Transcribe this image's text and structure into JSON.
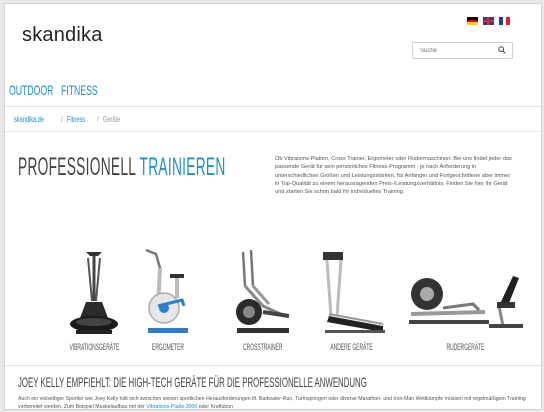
{
  "logo": "skandika",
  "languages": [
    {
      "code": "de",
      "colors": [
        "#000000",
        "#dd0000",
        "#ffce00"
      ]
    },
    {
      "code": "en",
      "colors": [
        "#2d3d8a",
        "#e22233",
        "#ffffff"
      ]
    },
    {
      "code": "fr",
      "colors": [
        "#1f3d99",
        "#ffffff",
        "#e22233"
      ]
    }
  ],
  "search": {
    "placeholder": "Suche"
  },
  "nav": {
    "items": [
      "OUTDOOR",
      "FITNESS"
    ]
  },
  "breadcrumb": [
    "skandika.de",
    "Fitness",
    "Geräte"
  ],
  "hero": {
    "title_part1": "PROFESSIONELL",
    "title_part2": "TRAINIEREN",
    "intro": "Ob Vibrations-Platten, Cross Trainer, Ergometer oder Rudermaschinen: Bei uns findet jeder das passende Gerät für sein persönliches Fitness-Programm - je nach Anforderung in unterschiedlichen Größen und Leistungsstärken, für Anfänger und Fortgeschrittene aber immer in Top-Qualität zu einem herausragenden Preis-/Leistungsverhältnis. Finden Sie hier Ihr Gerät und starten Sie schon bald Ihr individuelles Training."
  },
  "products": [
    {
      "label": "VIBRATIONSGERÄTE",
      "icon": "vibration-plate-icon"
    },
    {
      "label": "ERGOMETER",
      "icon": "ergometer-bike-icon"
    },
    {
      "label": "CROSSTRAINER",
      "icon": "crosstrainer-icon"
    },
    {
      "label": "ANDERE GERÄTE",
      "icon": "treadmill-icon"
    },
    {
      "label": "RUDERGERÄTE",
      "icon": "rowing-machine-icon"
    }
  ],
  "section2": {
    "title": "JOEY KELLY EMPFIEHLT: DIE HIGH-TECH GERÄTE FÜR DIE PROFESSIONELLE ANWENDUNG",
    "body_start": "Auch ein vielseitiger Sportler wie Joey Kelly hält sich zwischen seinen sportlichen Herausforderungen ift. Badwater-Run, Turmspringen oder diverse Marathon- und Iron-Man Wettkämpfe müssen mit regelmäßigem Training vorbereitet werden. Zum Beispiel Muskelaufbau mit der ",
    "body_link": "Vibrations-Platte 3000",
    "body_end": " oder Kraftübun"
  },
  "colors": {
    "accent": "#1c8fd0",
    "text": "#444444"
  }
}
